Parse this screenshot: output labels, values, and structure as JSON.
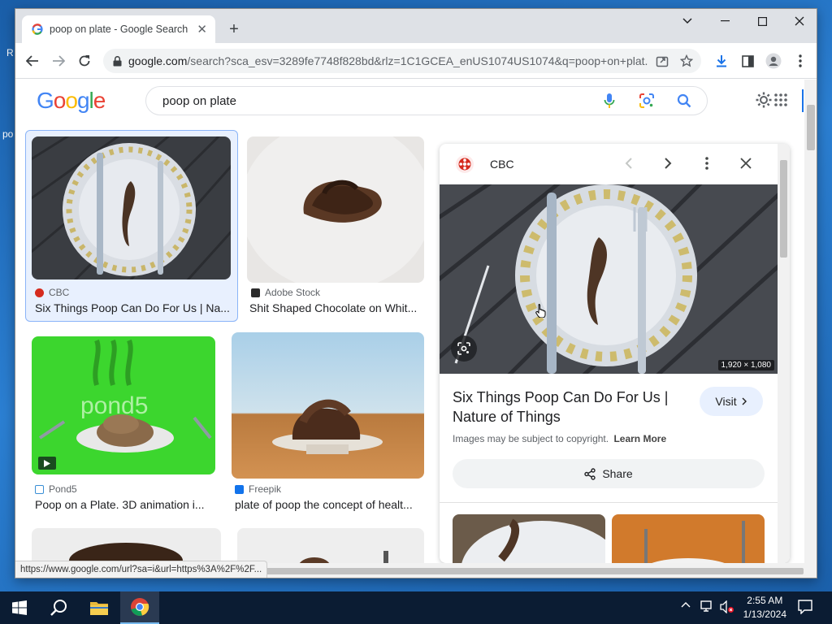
{
  "browser": {
    "tab_title": "poop on plate - Google Search",
    "url_host": "google.com",
    "url_path": "/search?sca_esv=3289fe7748f828bd&rlz=1C1GCEA_enUS1074US1074&q=poop+on+plat..."
  },
  "google": {
    "logo_letters": [
      "G",
      "o",
      "o",
      "g",
      "l",
      "e"
    ],
    "logo_colors": [
      "#4285F4",
      "#EA4335",
      "#FBBC05",
      "#4285F4",
      "#34A853",
      "#EA4335"
    ],
    "search_value": "poop on plate"
  },
  "results": [
    {
      "source": "CBC",
      "title": "Six Things Poop Can Do For Us | Na...",
      "favicon_color": "#d52b1e"
    },
    {
      "source": "Adobe Stock",
      "title": "Shit Shaped Chocolate on Whit...",
      "favicon_color": "#2b2b2b"
    },
    {
      "source": "Pond5",
      "title": "Poop on a Plate. 3D animation i...",
      "favicon_color": "#3a8fd6"
    },
    {
      "source": "Freepik",
      "title": "plate of poop the concept of healt...",
      "favicon_color": "#1273eb"
    }
  ],
  "preview": {
    "source": "CBC",
    "dimensions": "1,920 × 1,080",
    "title": "Six Things Poop Can Do For Us | Nature of Things",
    "copyright_text": "Images may be subject to copyright.",
    "learn_more": "Learn More",
    "visit_label": "Visit",
    "share_label": "Share"
  },
  "status_url": "https://www.google.com/url?sa=i&url=https%3A%2F%2F...",
  "taskbar": {
    "time": "2:55 AM",
    "date": "1/13/2024"
  },
  "desktop": {
    "fragment_r": "R",
    "fragment_po": "po"
  }
}
